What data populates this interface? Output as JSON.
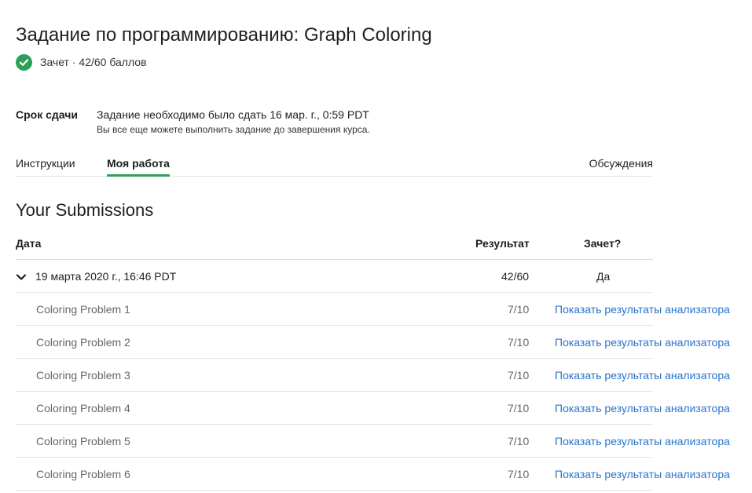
{
  "header": {
    "title": "Задание по программированию: Graph Coloring",
    "status_text": "Зачет · 42/60 баллов"
  },
  "due": {
    "label": "Срок сдачи",
    "main": "Задание необходимо было сдать 16 мар. г., 0:59 PDT",
    "note": "Вы все еще можете выполнить задание до завершения курса."
  },
  "tabs": [
    {
      "label": "Инструкции",
      "active": false
    },
    {
      "label": "Моя работа",
      "active": true
    },
    {
      "label": "Обсуждения",
      "active": false
    }
  ],
  "submissions": {
    "title": "Your Submissions",
    "columns": {
      "date": "Дата",
      "result": "Результат",
      "pass": "Зачет?"
    },
    "submission": {
      "date": "19 марта 2020 г., 16:46 PDT",
      "result": "42/60",
      "pass": "Да"
    },
    "problems": [
      {
        "name": "Coloring Problem 1",
        "score": "7/10",
        "link": "Показать результаты анализатора"
      },
      {
        "name": "Coloring Problem 2",
        "score": "7/10",
        "link": "Показать результаты анализатора"
      },
      {
        "name": "Coloring Problem 3",
        "score": "7/10",
        "link": "Показать результаты анализатора"
      },
      {
        "name": "Coloring Problem 4",
        "score": "7/10",
        "link": "Показать результаты анализатора"
      },
      {
        "name": "Coloring Problem 5",
        "score": "7/10",
        "link": "Показать результаты анализатора"
      },
      {
        "name": "Coloring Problem 6",
        "score": "7/10",
        "link": "Показать результаты анализатора"
      }
    ]
  },
  "colors": {
    "accent": "#2e9e5b",
    "link": "#2a73cc"
  },
  "icons": {
    "status": "check-circle-icon",
    "expand": "chevron-down-icon"
  }
}
